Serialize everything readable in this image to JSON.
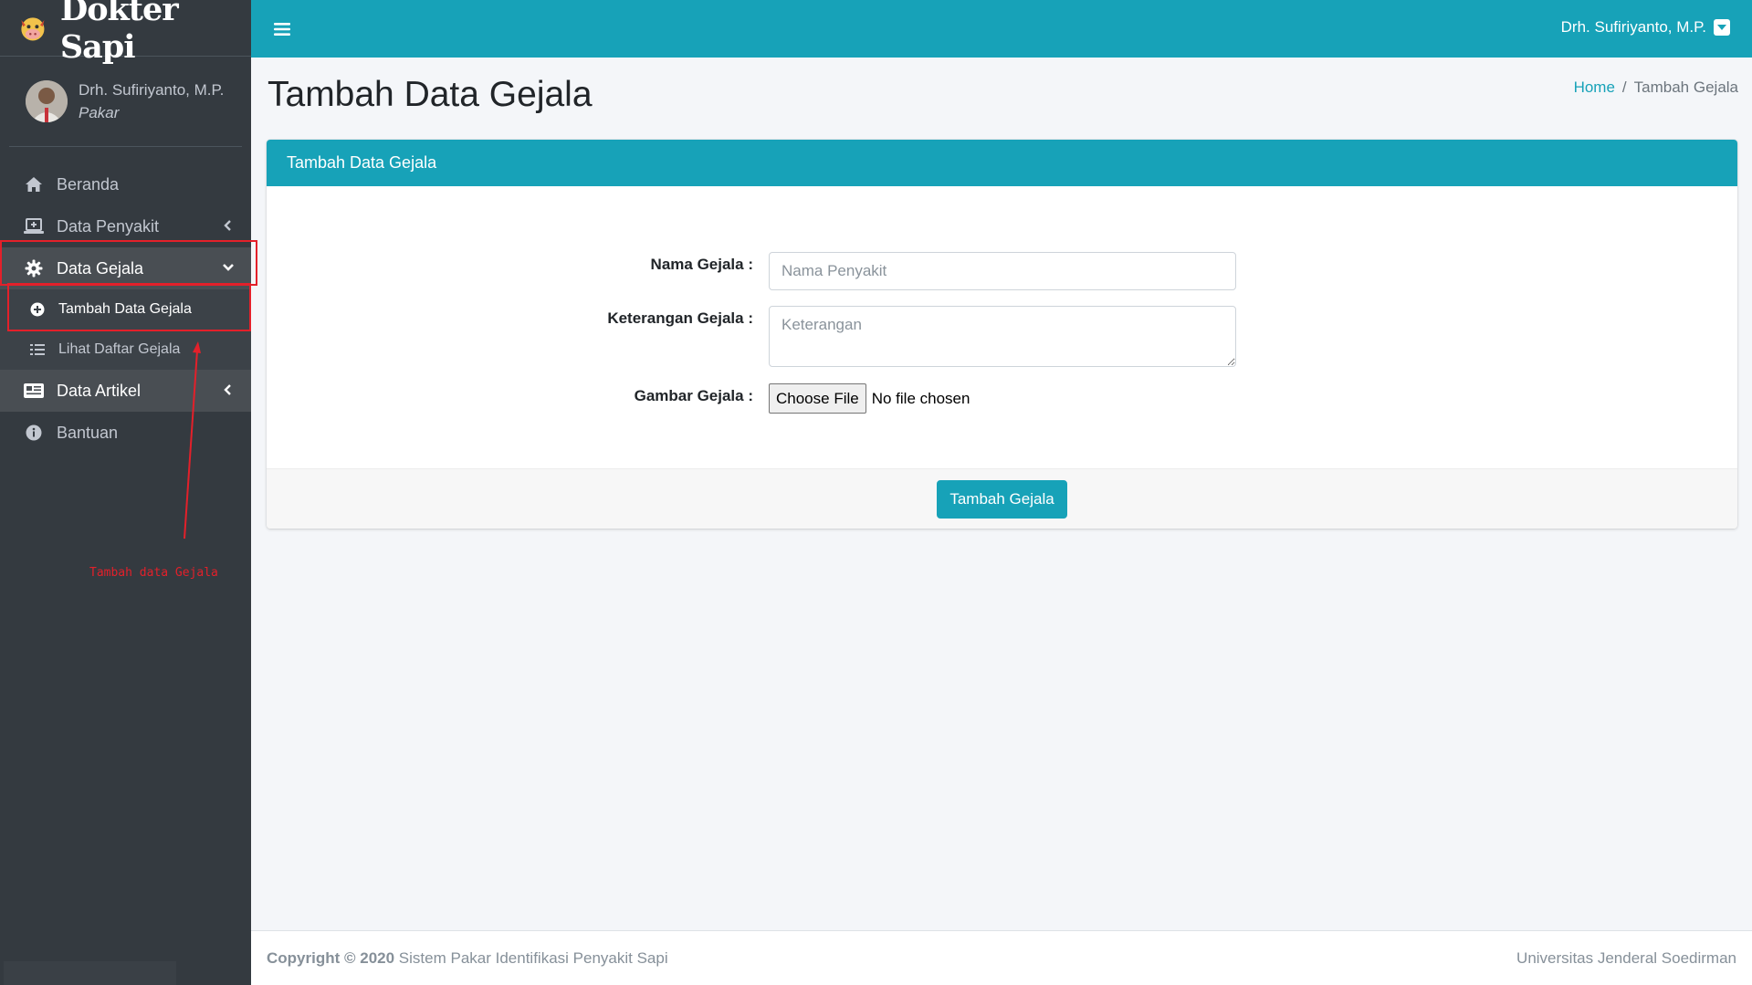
{
  "brand": {
    "name": "Dokter Sapi"
  },
  "user": {
    "name": "Drh. Sufiriyanto, M.P.",
    "role": "Pakar"
  },
  "sidebar": {
    "items": [
      {
        "label": "Beranda",
        "icon": "home-icon"
      },
      {
        "label": "Data Penyakit",
        "icon": "laptop-medical-icon"
      },
      {
        "label": "Data Gejala",
        "icon": "gear-icon"
      },
      {
        "label": "Data Artikel",
        "icon": "newspaper-icon"
      },
      {
        "label": "Bantuan",
        "icon": "info-circle-icon"
      }
    ],
    "gejala_sub": [
      {
        "label": "Tambah Data Gejala",
        "icon": "plus-circle-icon"
      },
      {
        "label": "Lihat Daftar Gejala",
        "icon": "list-icon"
      }
    ]
  },
  "annotation": {
    "text": "Tambah data Gejala"
  },
  "topbar": {
    "user": "Drh. Sufiriyanto, M.P."
  },
  "page": {
    "title": "Tambah Data Gejala"
  },
  "breadcrumb": {
    "home": "Home",
    "sep": "/",
    "current": "Tambah Gejala"
  },
  "card": {
    "title": "Tambah Data Gejala"
  },
  "form": {
    "nama_label": "Nama Gejala :",
    "nama_placeholder": "Nama Penyakit",
    "keterangan_label": "Keterangan Gejala :",
    "keterangan_placeholder": "Keterangan",
    "gambar_label": "Gambar Gejala :",
    "file_button": "Choose File",
    "file_status": "No file chosen",
    "submit": "Tambah Gejala"
  },
  "footer": {
    "copyright": "Copyright © 2020",
    "app": "Sistem Pakar Identifikasi Penyakit Sapi",
    "institution": "Universitas Jenderal Soedirman"
  },
  "colors": {
    "primary": "#17a2b8",
    "sidebar": "#343a40",
    "annotation": "#e3202a"
  }
}
